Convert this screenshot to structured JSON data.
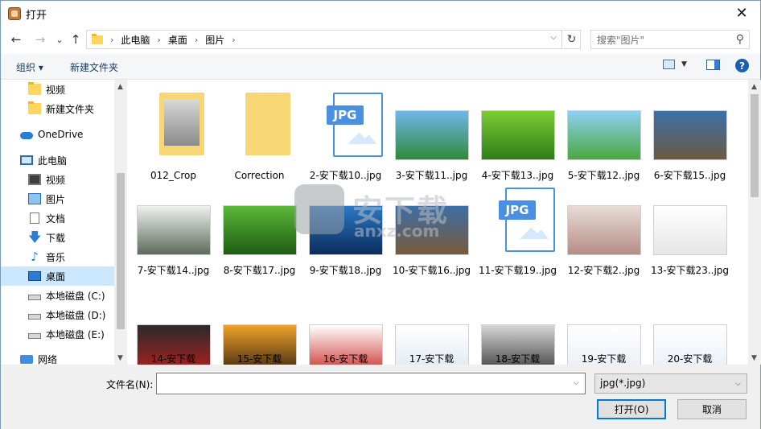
{
  "window": {
    "title": "打开",
    "close_glyph": "✕"
  },
  "nav": {
    "back": "←",
    "forward": "→",
    "recent": "⌄",
    "up": "↑",
    "breadcrumbs": [
      "此电脑",
      "桌面",
      "图片"
    ],
    "refresh": "↻",
    "search_placeholder": "搜索\"图片\""
  },
  "toolbar": {
    "organize": "组织 ▾",
    "new_folder": "新建文件夹",
    "help": "?"
  },
  "sidebar": {
    "items": [
      {
        "label": "视频",
        "icon": "folder-icon"
      },
      {
        "label": "新建文件夹",
        "icon": "folder-icon"
      },
      {
        "label": "OneDrive",
        "icon": "cloud-icon"
      },
      {
        "label": "此电脑",
        "icon": "computer-icon"
      },
      {
        "label": "视频",
        "icon": "video-icon"
      },
      {
        "label": "图片",
        "icon": "pictures-icon"
      },
      {
        "label": "文档",
        "icon": "documents-icon"
      },
      {
        "label": "下载",
        "icon": "download-icon"
      },
      {
        "label": "音乐",
        "icon": "music-icon"
      },
      {
        "label": "桌面",
        "icon": "desktop-icon",
        "selected": true
      },
      {
        "label": "本地磁盘 (C:)",
        "icon": "drive-icon"
      },
      {
        "label": "本地磁盘 (D:)",
        "icon": "drive-icon"
      },
      {
        "label": "本地磁盘 (E:)",
        "icon": "drive-icon"
      },
      {
        "label": "网络",
        "icon": "network-icon"
      }
    ]
  },
  "files": [
    {
      "name": "012_Crop",
      "kind": "folder-crop"
    },
    {
      "name": "Correction",
      "kind": "folder"
    },
    {
      "name": "2-安下载10..jpg",
      "kind": "jpg-doc"
    },
    {
      "name": "3-安下载11..jpg",
      "kind": "photo",
      "colors": [
        "#6fb6ea",
        "#2f8a3a"
      ]
    },
    {
      "name": "4-安下载13..jpg",
      "kind": "photo",
      "colors": [
        "#7ccc34",
        "#2e7d19"
      ]
    },
    {
      "name": "5-安下载12..jpg",
      "kind": "photo",
      "colors": [
        "#8fd0f2",
        "#4aa83e"
      ]
    },
    {
      "name": "6-安下载15..jpg",
      "kind": "photo",
      "colors": [
        "#3d6fa8",
        "#6b5a42"
      ]
    },
    {
      "name": "7-安下载14..jpg",
      "kind": "photo",
      "colors": [
        "#eef1ee",
        "#5d6b5d"
      ]
    },
    {
      "name": "8-安下载17..jpg",
      "kind": "photo",
      "colors": [
        "#5cb83a",
        "#1e5c14"
      ]
    },
    {
      "name": "9-安下载18..jpg",
      "kind": "photo",
      "colors": [
        "#2a79c7",
        "#0b2c5c"
      ]
    },
    {
      "name": "10-安下载16..jpg",
      "kind": "photo",
      "colors": [
        "#3c6ea6",
        "#7a5a3a"
      ]
    },
    {
      "name": "11-安下载19..jpg",
      "kind": "jpg-doc"
    },
    {
      "name": "12-安下载2..jpg",
      "kind": "photo",
      "colors": [
        "#e8dcd6",
        "#b58d86"
      ]
    },
    {
      "name": "13-安下载23..jpg",
      "kind": "photo",
      "colors": [
        "#ffffff",
        "#e6e6e6"
      ]
    },
    {
      "name": "14-安下载",
      "kind": "photo",
      "colors": [
        "#2a2a2a",
        "#b52020"
      ]
    },
    {
      "name": "15-安下载",
      "kind": "photo",
      "colors": [
        "#f0a22a",
        "#3a2410"
      ]
    },
    {
      "name": "16-安下载",
      "kind": "photo",
      "colors": [
        "#ffffff",
        "#c9302c"
      ]
    },
    {
      "name": "17-安下载",
      "kind": "photo",
      "colors": [
        "#ffffff",
        "#dfe8f2"
      ]
    },
    {
      "name": "18-安下载",
      "kind": "photo",
      "colors": [
        "#d8d8d8",
        "#3a3a3a"
      ]
    },
    {
      "name": "19-安下载",
      "kind": "photo",
      "colors": [
        "#ffffff",
        "#e8eef5"
      ]
    },
    {
      "name": "20-安下载",
      "kind": "photo",
      "colors": [
        "#ffffff",
        "#e8eef5"
      ]
    }
  ],
  "watermark": {
    "text": "安下载",
    "sub": "anxz.com"
  },
  "bottom": {
    "filename_label": "文件名(N):",
    "filename_value": "",
    "filetype_value": "jpg(*.jpg)",
    "open_button": "打开(O)",
    "cancel_button": "取消"
  },
  "colors": {
    "accent": "#0078d7",
    "selection": "#cce8ff",
    "folder": "#f8d674",
    "jpg_badge": "#4a90e2"
  }
}
